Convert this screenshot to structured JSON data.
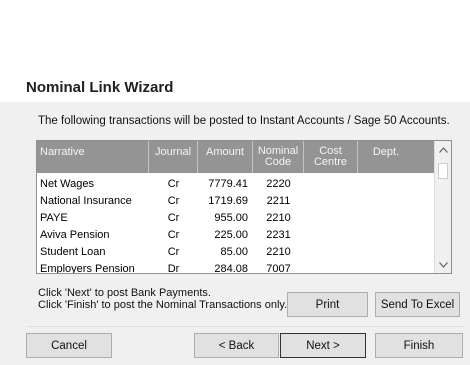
{
  "wizard": {
    "title": "Nominal Link Wizard",
    "intro": "The following transactions will be posted to Instant Accounts / Sage 50 Accounts."
  },
  "grid": {
    "columns": [
      "Narrative",
      "Journal",
      "Amount",
      "Nominal Code",
      "Cost Centre",
      "Dept."
    ],
    "rows": [
      {
        "narrative": "Net Wages",
        "journal": "Cr",
        "amount": "7779.41",
        "nominal": "2220"
      },
      {
        "narrative": "National Insurance",
        "journal": "Cr",
        "amount": "1719.69",
        "nominal": "2211"
      },
      {
        "narrative": "PAYE",
        "journal": "Cr",
        "amount": "955.00",
        "nominal": "2210"
      },
      {
        "narrative": "Aviva Pension",
        "journal": "Cr",
        "amount": "225.00",
        "nominal": "2231"
      },
      {
        "narrative": "Student Loan",
        "journal": "Cr",
        "amount": "85.00",
        "nominal": "2210"
      },
      {
        "narrative": "Employers Pension",
        "journal": "Dr",
        "amount": "284.08",
        "nominal": "7007"
      }
    ]
  },
  "hint": {
    "line1": "Click 'Next' to post Bank Payments.",
    "line2": "Click 'Finish' to post the Nominal Transactions only."
  },
  "buttons": {
    "print": "Print",
    "send_to_excel": "Send To Excel",
    "cancel": "Cancel",
    "back": "< Back",
    "next": "Next >",
    "finish": "Finish"
  },
  "icons": {
    "scroll_up": "scroll-up-icon",
    "scroll_down": "scroll-down-icon"
  }
}
